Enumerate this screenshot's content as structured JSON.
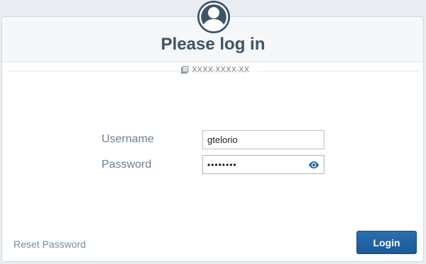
{
  "header": {
    "title": "Please log in",
    "serial": "XXXX-XXXX-XX",
    "avatar_icon": "user-circle-icon",
    "serial_icon": "device-icon"
  },
  "form": {
    "username_label": "Username",
    "username_value": "gtelorio",
    "password_label": "Password",
    "password_value_masked": "••••••••",
    "show_password_icon": "eye-icon"
  },
  "footer": {
    "reset_password": "Reset Password",
    "login": "Login"
  },
  "colors": {
    "title": "#3f5465",
    "primary": "#1a5a97",
    "link": "#6f8fa6"
  }
}
